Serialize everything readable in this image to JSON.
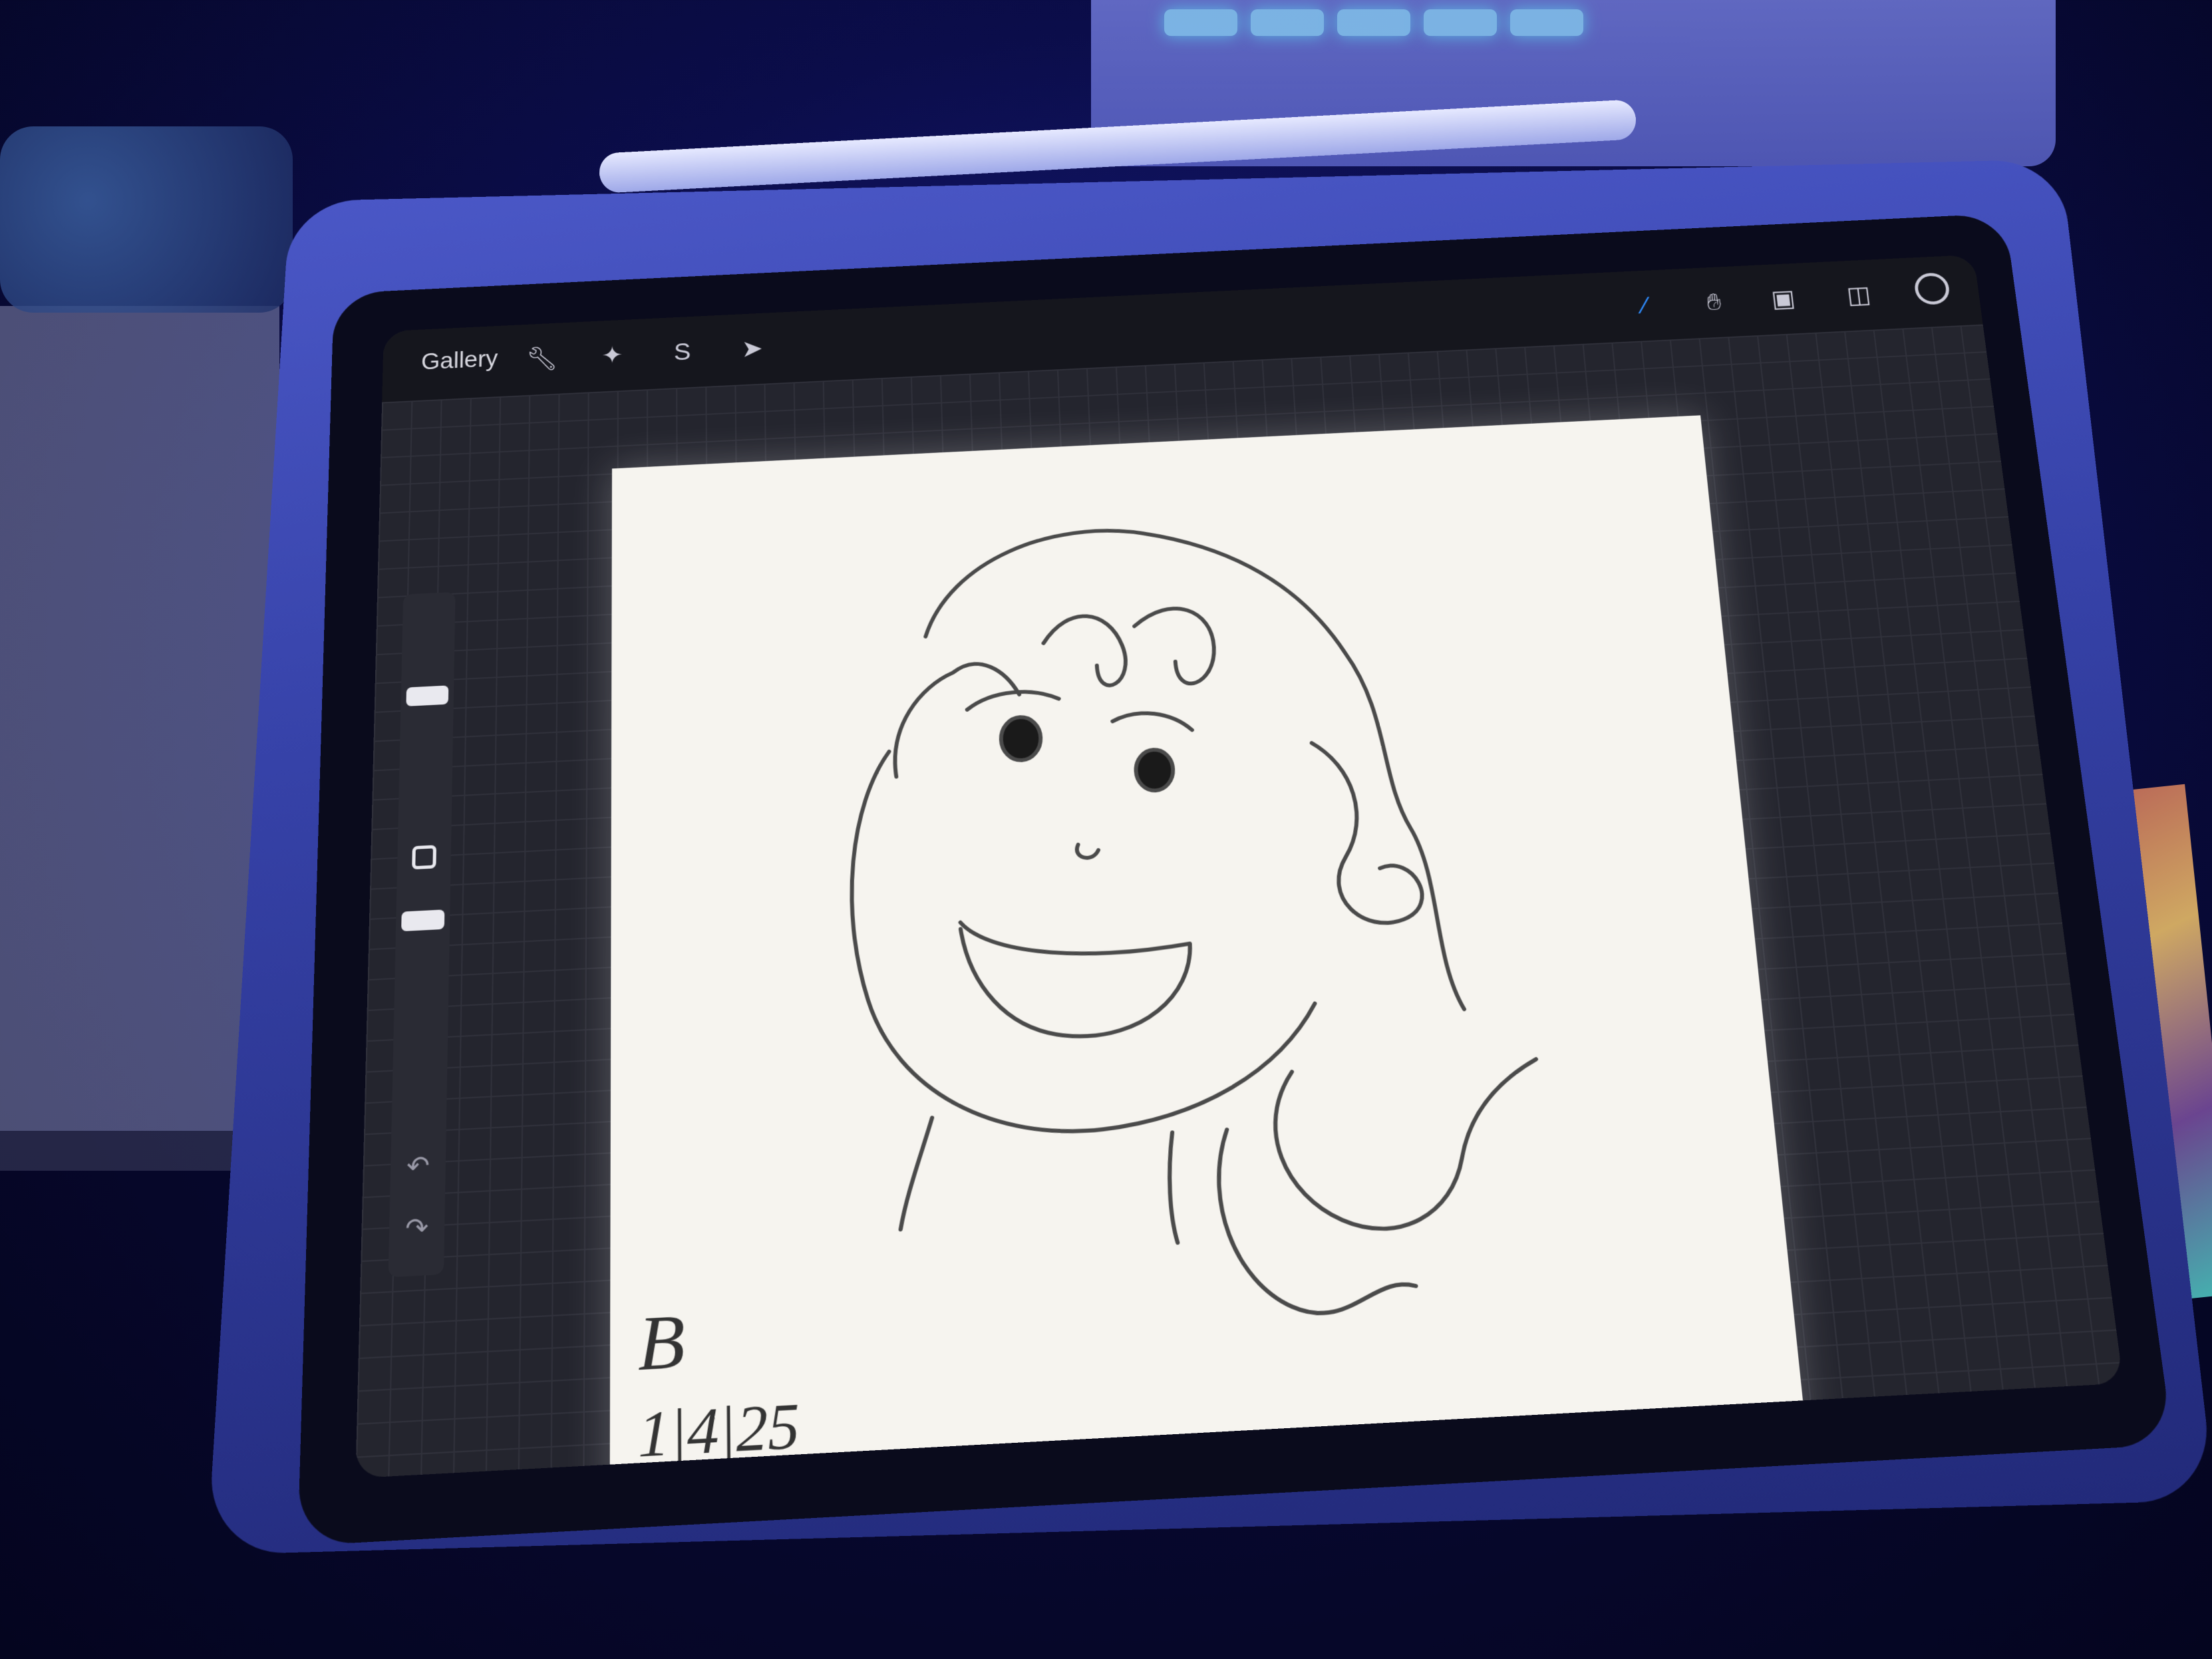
{
  "toolbar": {
    "gallery_label": "Gallery",
    "left_icons": [
      "wrench-icon",
      "magic-wand-icon",
      "selection-s-icon",
      "transform-arrow-icon"
    ],
    "right_icons": [
      "brush-icon",
      "smudge-icon",
      "eraser-icon",
      "layers-icon"
    ],
    "active_tool": "brush-icon"
  },
  "sidebar": {
    "brush_size_level": 0.25,
    "opacity_level": 0.75
  },
  "canvas": {
    "signature_initial": "B",
    "signature_date": "1|4|25"
  },
  "colors": {
    "accent": "#2f8dff",
    "canvas": "#f6f4ef",
    "ambient": "#1a1f8a"
  }
}
